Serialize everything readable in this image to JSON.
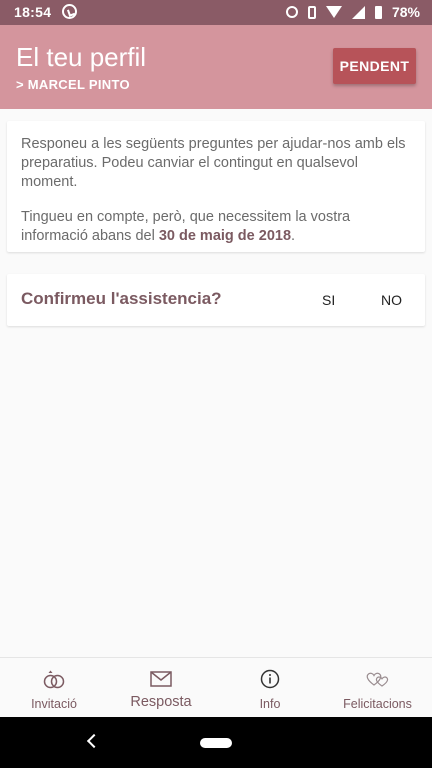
{
  "status_bar": {
    "time": "18:54",
    "battery": "78%"
  },
  "header": {
    "title": "El teu perfil",
    "subtitle": ">  MARCEL PINTO",
    "pending_label": "PENDENT"
  },
  "intro": {
    "paragraph1": "Responeu a les següents preguntes per ajudar-nos amb els preparatius. Podeu canviar el contingut en qualsevol moment.",
    "paragraph2_prefix": "Tingueu en compte, però, que necessitem la vostra informació abans del ",
    "deadline": "30 de maig de 2018",
    "paragraph2_suffix": "."
  },
  "question": {
    "text": "Confirmeu l'assistencia?",
    "yes_label": "SI",
    "no_label": "NO"
  },
  "bottom_nav": {
    "items": [
      {
        "label": "Invitació",
        "icon": "rings-icon"
      },
      {
        "label": "Resposta",
        "icon": "envelope-icon"
      },
      {
        "label": "Info",
        "icon": "info-icon"
      },
      {
        "label": "Felicitacions",
        "icon": "hearts-icon"
      }
    ]
  },
  "colors": {
    "status_bar": "#8a5b66",
    "header": "#d4959d",
    "accent_button": "#b75359",
    "brand_text": "#7b5a61"
  }
}
